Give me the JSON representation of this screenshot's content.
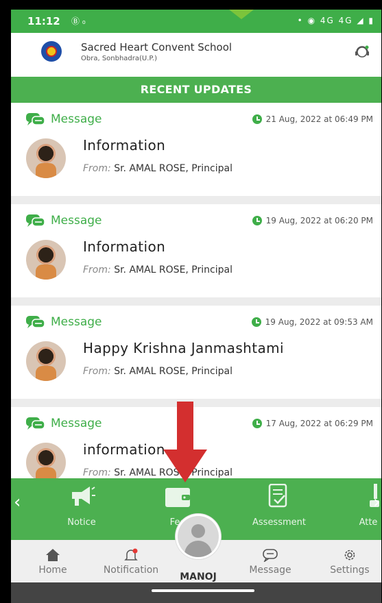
{
  "status_bar": {
    "time": "11:12",
    "left_icons_text": "Ⓑ ₀",
    "right_icons_text": "• ◉ 4G 4G ◢ ▮"
  },
  "header": {
    "school_name": "Sacred Heart Convent School",
    "school_place": "Obra, Sonbhadra(U.P.)"
  },
  "section_title": "RECENT UPDATES",
  "feed": {
    "items": [
      {
        "type_label": "Message",
        "date": "21 Aug, 2022 at 06:49 PM",
        "subject": "Information",
        "from_label": "From:",
        "from_value": "Sr. AMAL ROSE, Principal"
      },
      {
        "type_label": "Message",
        "date": "19 Aug, 2022 at 06:20 PM",
        "subject": "Information",
        "from_label": "From:",
        "from_value": "Sr. AMAL ROSE, Principal"
      },
      {
        "type_label": "Message",
        "date": "19 Aug, 2022 at 09:53 AM",
        "subject": "Happy Krishna Janmashtami",
        "from_label": "From:",
        "from_value": "Sr. AMAL ROSE, Principal"
      },
      {
        "type_label": "Message",
        "date": "17 Aug, 2022 at 06:29 PM",
        "subject": "information",
        "from_label": "From:",
        "from_value": "Sr. AMAL ROSE, Principal"
      }
    ]
  },
  "features": {
    "items": [
      {
        "label": "Notice",
        "icon": "megaphone-icon"
      },
      {
        "label": "Fee",
        "icon": "wallet-icon"
      },
      {
        "label": "Assessment",
        "icon": "checklist-icon"
      },
      {
        "label": "Atte",
        "icon": "attendance-icon"
      }
    ],
    "prev": "‹",
    "next": "›"
  },
  "bottom_nav": {
    "items": [
      {
        "label": "Home",
        "icon": "home-icon"
      },
      {
        "label": "Notification",
        "icon": "bell-icon"
      },
      {
        "label": "Message",
        "icon": "chat-icon"
      },
      {
        "label": "Settings",
        "icon": "gear-icon"
      }
    ],
    "profile_name": "MANOJ"
  },
  "colors": {
    "brand_green": "#4cb050",
    "status_green": "#3fae49",
    "arrow_red": "#d32f2f"
  }
}
